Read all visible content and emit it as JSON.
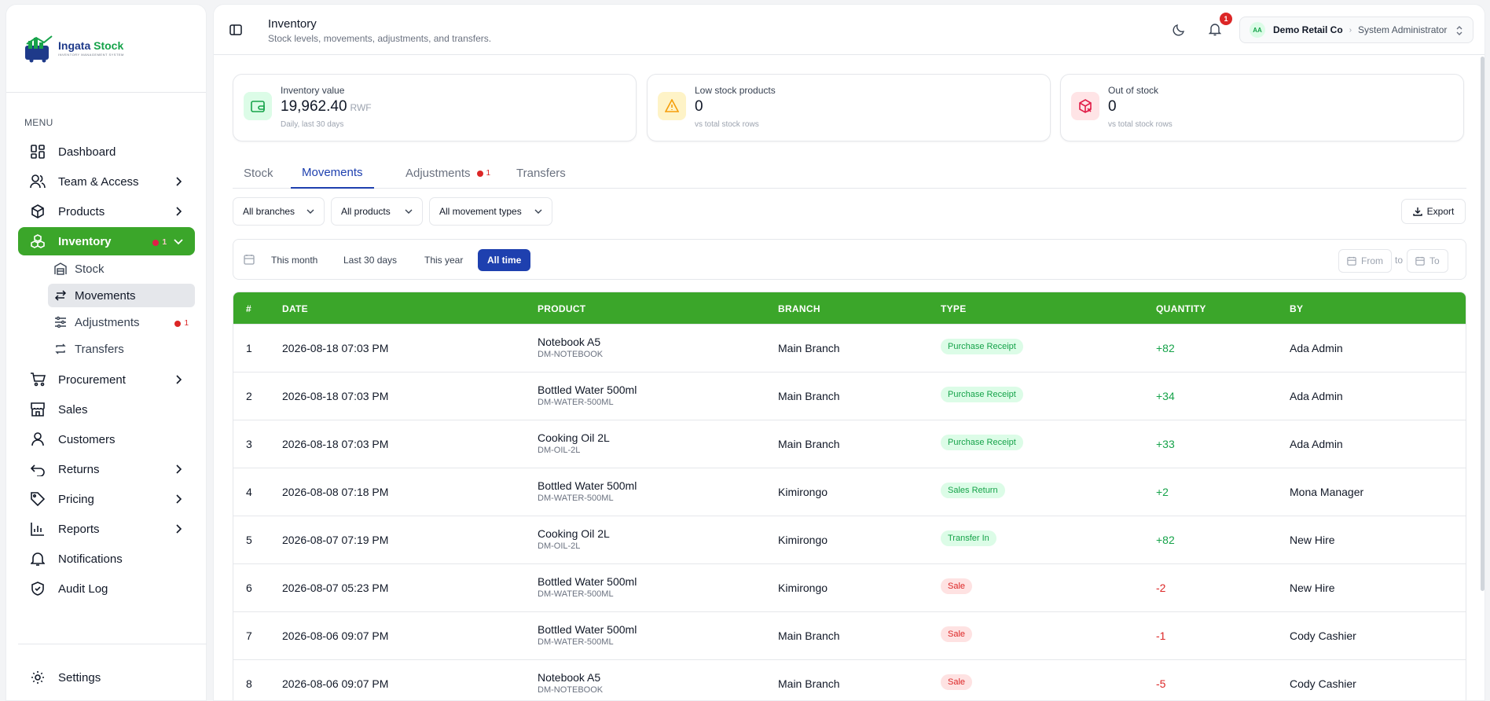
{
  "brand": {
    "name": "Ingata",
    "name_accent": "Stock",
    "tagline": "INVENTORY MANAGEMENT SYSTEM"
  },
  "sidebar": {
    "menu_label": "MENU",
    "items": [
      {
        "label": "Dashboard",
        "icon": "grid-icon"
      },
      {
        "label": "Team & Access",
        "icon": "users-icon"
      },
      {
        "label": "Products",
        "icon": "box-icon"
      },
      {
        "label": "Inventory",
        "icon": "boxes-icon",
        "badge": "1"
      },
      {
        "label": "Procurement",
        "icon": "cart-icon"
      },
      {
        "label": "Sales",
        "icon": "store-icon"
      },
      {
        "label": "Customers",
        "icon": "user-icon"
      },
      {
        "label": "Returns",
        "icon": "undo-icon"
      },
      {
        "label": "Pricing",
        "icon": "tag-icon"
      },
      {
        "label": "Reports",
        "icon": "chart-icon"
      },
      {
        "label": "Notifications",
        "icon": "bell-icon"
      },
      {
        "label": "Audit Log",
        "icon": "shield-icon"
      },
      {
        "label": "Settings",
        "icon": "gear-icon"
      }
    ],
    "inventory_sub": [
      {
        "label": "Stock"
      },
      {
        "label": "Movements"
      },
      {
        "label": "Adjustments",
        "badge": "1"
      },
      {
        "label": "Transfers"
      }
    ]
  },
  "header": {
    "title": "Inventory",
    "subtitle": "Stock levels, movements, adjustments, and transfers.",
    "notification_count": "1",
    "org_initials": "AA",
    "org_name": "Demo Retail Co",
    "role": "System Administrator"
  },
  "kpis": [
    {
      "label": "Inventory value",
      "value": "19,962.40",
      "unit": "RWF",
      "sub": "Daily, last 30 days",
      "color": "#16a34a"
    },
    {
      "label": "Low stock products",
      "value": "0",
      "unit": "",
      "sub": "vs total stock rows",
      "color": "#f59e0b"
    },
    {
      "label": "Out of stock",
      "value": "0",
      "unit": "",
      "sub": "vs total stock rows",
      "color": "#e11d48"
    }
  ],
  "tabs": [
    {
      "label": "Stock"
    },
    {
      "label": "Movements",
      "active": true
    },
    {
      "label": "Adjustments",
      "badge": "1"
    },
    {
      "label": "Transfers"
    }
  ],
  "filters": {
    "branch": "All branches",
    "product": "All products",
    "movement_type": "All movement types",
    "export_label": "Export"
  },
  "date_range": {
    "presets": [
      "This month",
      "Last 30 days",
      "This year",
      "All time"
    ],
    "active": "All time",
    "from_placeholder": "From",
    "to_label": "to",
    "to_placeholder": "To"
  },
  "table": {
    "headers": [
      "#",
      "DATE",
      "PRODUCT",
      "BRANCH",
      "TYPE",
      "QUANTITY",
      "BY"
    ],
    "rows": [
      {
        "n": "1",
        "date": "2026-08-18 07:03 PM",
        "product": "Notebook A5",
        "sku": "DM-NOTEBOOK",
        "branch": "Main Branch",
        "type": "Purchase Receipt",
        "qty": "+82",
        "by": "Ada Admin"
      },
      {
        "n": "2",
        "date": "2026-08-18 07:03 PM",
        "product": "Bottled Water 500ml",
        "sku": "DM-WATER-500ML",
        "branch": "Main Branch",
        "type": "Purchase Receipt",
        "qty": "+34",
        "by": "Ada Admin"
      },
      {
        "n": "3",
        "date": "2026-08-18 07:03 PM",
        "product": "Cooking Oil 2L",
        "sku": "DM-OIL-2L",
        "branch": "Main Branch",
        "type": "Purchase Receipt",
        "qty": "+33",
        "by": "Ada Admin"
      },
      {
        "n": "4",
        "date": "2026-08-08 07:18 PM",
        "product": "Bottled Water 500ml",
        "sku": "DM-WATER-500ML",
        "branch": "Kimirongo",
        "type": "Sales Return",
        "qty": "+2",
        "by": "Mona Manager"
      },
      {
        "n": "5",
        "date": "2026-08-07 07:19 PM",
        "product": "Cooking Oil 2L",
        "sku": "DM-OIL-2L",
        "branch": "Kimirongo",
        "type": "Transfer In",
        "qty": "+82",
        "by": "New Hire"
      },
      {
        "n": "6",
        "date": "2026-08-07 05:23 PM",
        "product": "Bottled Water 500ml",
        "sku": "DM-WATER-500ML",
        "branch": "Kimirongo",
        "type": "Sale",
        "qty": "-2",
        "by": "New Hire"
      },
      {
        "n": "7",
        "date": "2026-08-06 09:07 PM",
        "product": "Bottled Water 500ml",
        "sku": "DM-WATER-500ML",
        "branch": "Main Branch",
        "type": "Sale",
        "qty": "-1",
        "by": "Cody Cashier"
      },
      {
        "n": "8",
        "date": "2026-08-06 09:07 PM",
        "product": "Notebook A5",
        "sku": "DM-NOTEBOOK",
        "branch": "Main Branch",
        "type": "Sale",
        "qty": "-5",
        "by": "Cody Cashier"
      }
    ]
  },
  "colors": {
    "primary_green": "#3ba62a",
    "accent_blue": "#1e40af",
    "positive": "#16a34a",
    "negative": "#dc2626"
  }
}
